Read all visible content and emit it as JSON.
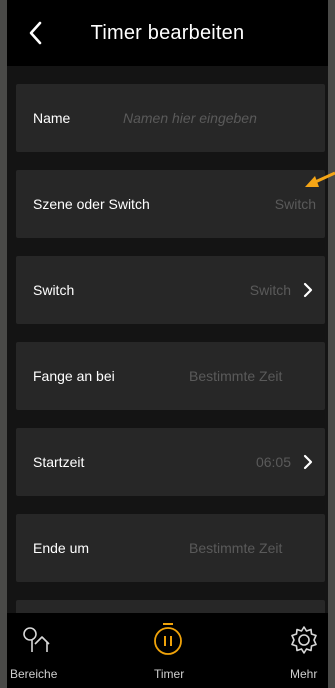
{
  "header": {
    "title": "Timer bearbeiten",
    "back_icon": "chevron-left-icon"
  },
  "rows": {
    "name": {
      "label": "Name",
      "placeholder": "Namen hier eingeben"
    },
    "scene_or_switch": {
      "label": "Szene oder Switch",
      "value": "Switch"
    },
    "switch": {
      "label": "Switch",
      "value": "Switch"
    },
    "start_at": {
      "label": "Fange an bei",
      "value": "Bestimmte Zeit"
    },
    "start_time": {
      "label": "Startzeit",
      "value": "06:05"
    },
    "end_at": {
      "label": "Ende um",
      "value": "Bestimmte Zeit"
    }
  },
  "tabbar": {
    "tabs": [
      {
        "label": "Bereiche",
        "icon": "rooms-icon"
      },
      {
        "label": "Timer",
        "icon": "timer-icon",
        "active": true
      },
      {
        "label": "Mehr",
        "icon": "gear-icon"
      }
    ]
  },
  "colors": {
    "background": "#141414",
    "header_bg": "#000000",
    "row_bg": "#272727",
    "value_text": "#5a5a5a",
    "accent": "#f0a30a",
    "annotation_arrow": "#f5a516"
  }
}
